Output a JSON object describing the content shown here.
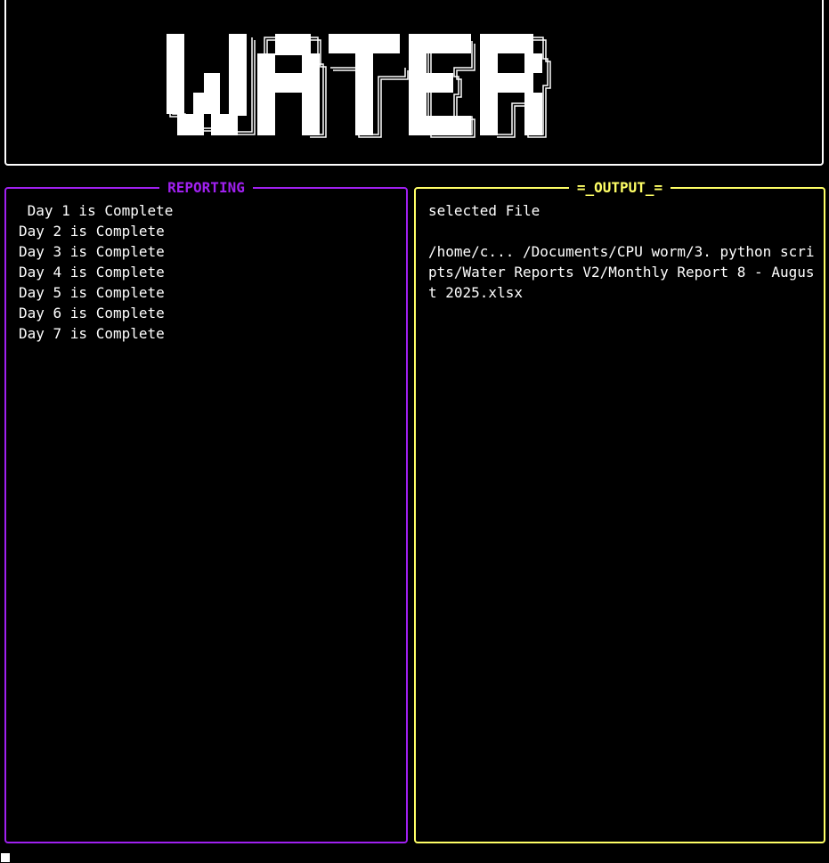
{
  "banner": {
    "logo_text": "WATER",
    "border_color": "#ffffff"
  },
  "reporting_panel": {
    "title": "REPORTING",
    "accent_color": "#a020f0",
    "lines": [
      " Day 1 is Complete",
      "Day 2 is Complete",
      "Day 3 is Complete",
      "Day 4 is Complete",
      "Day 5 is Complete",
      "Day 6 is Complete",
      "Day 7 is Complete"
    ]
  },
  "output_panel": {
    "title": "=_OUTPUT_=",
    "accent_color": "#ffff66",
    "heading": "selected File",
    "path": "/home/c...  /Documents/CPU worm/3. python scripts/Water Reports V2/Monthly Report 8 - August 2025.xlsx"
  },
  "terminal": {
    "cursor_icon": "block-cursor-icon"
  }
}
